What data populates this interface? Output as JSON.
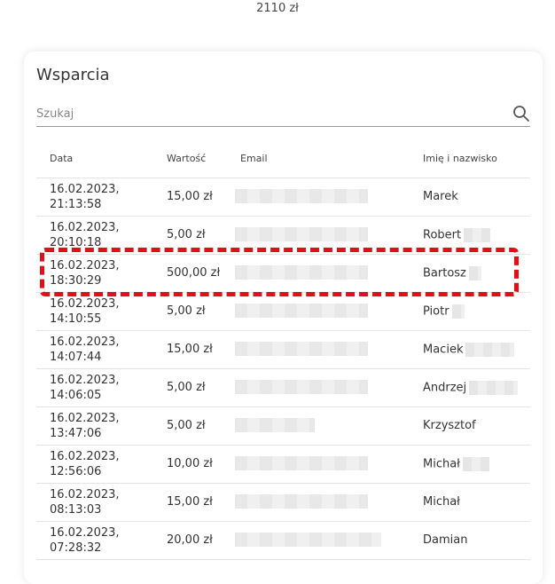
{
  "total_amount": "2110 zł",
  "card": {
    "title": "Wsparcia",
    "search_placeholder": "Szukaj"
  },
  "columns": {
    "date": "Data",
    "value": "Wartość",
    "email": "Email",
    "name": "Imię i nazwisko"
  },
  "rows": [
    {
      "date1": "16.02.2023,",
      "date2": "21:13:58",
      "value": "15,00 zł",
      "name": "Marek"
    },
    {
      "date1": "16.02.2023,",
      "date2": "20:10:18",
      "value": "5,00 zł",
      "name": "Robert"
    },
    {
      "date1": "16.02.2023,",
      "date2": "18:30:29",
      "value": "500,00 zł",
      "name": "Bartosz"
    },
    {
      "date1": "16.02.2023,",
      "date2": "14:10:55",
      "value": "5,00 zł",
      "name": "Piotr"
    },
    {
      "date1": "16.02.2023,",
      "date2": "14:07:44",
      "value": "15,00 zł",
      "name": "Maciek"
    },
    {
      "date1": "16.02.2023,",
      "date2": "14:06:05",
      "value": "5,00 zł",
      "name": "Andrzej"
    },
    {
      "date1": "16.02.2023,",
      "date2": "13:47:06",
      "value": "5,00 zł",
      "name": "Krzysztof"
    },
    {
      "date1": "16.02.2023,",
      "date2": "12:56:06",
      "value": "10,00 zł",
      "name": "Michał"
    },
    {
      "date1": "16.02.2023,",
      "date2": "08:13:03",
      "value": "15,00 zł",
      "name": "Michał"
    },
    {
      "date1": "16.02.2023,",
      "date2": "07:28:32",
      "value": "20,00 zł",
      "name": "Damian"
    }
  ],
  "colors": {
    "highlight": "#e0101a"
  }
}
